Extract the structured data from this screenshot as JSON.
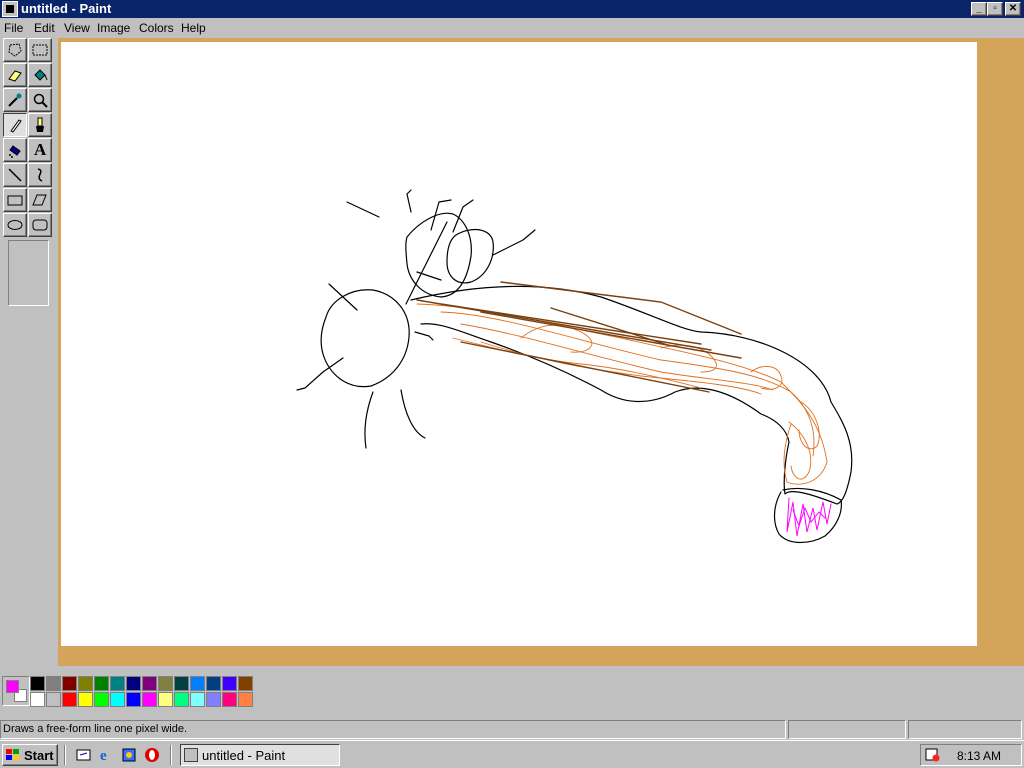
{
  "window": {
    "title": "untitled - Paint"
  },
  "menu": [
    "File",
    "Edit",
    "View",
    "Image",
    "Colors",
    "Help"
  ],
  "toolbox": {
    "tools": [
      "free-form-select",
      "select",
      "eraser",
      "fill-with-color",
      "pick-color",
      "magnifier",
      "pencil",
      "brush",
      "airbrush",
      "text",
      "line",
      "curve",
      "rectangle",
      "polygon",
      "ellipse",
      "rounded-rectangle"
    ],
    "active_tool": "pencil",
    "text_tool_glyph": "A"
  },
  "colors": {
    "foreground": "#ff00ff",
    "background": "#ffffff",
    "palette_top": [
      "#000000",
      "#808080",
      "#800000",
      "#808000",
      "#008000",
      "#008080",
      "#000080",
      "#800080",
      "#808040",
      "#004040",
      "#0080ff",
      "#004080",
      "#4000ff",
      "#804000"
    ],
    "palette_bottom": [
      "#ffffff",
      "#c0c0c0",
      "#ff0000",
      "#ffff00",
      "#00ff00",
      "#00ffff",
      "#0000ff",
      "#ff00ff",
      "#ffff80",
      "#00ff80",
      "#80ffff",
      "#8080ff",
      "#ff0080",
      "#ff8040"
    ],
    "workspace": "#d4a45a"
  },
  "status": {
    "text": "Draws a free-form line one pixel wide."
  },
  "taskbar": {
    "start_label": "Start",
    "quick_launch": [
      "show-desktop-icon",
      "internet-explorer-icon",
      "channels-icon",
      "opera-icon"
    ],
    "task_label": "untitled - Paint",
    "clock": "8:13 AM"
  }
}
